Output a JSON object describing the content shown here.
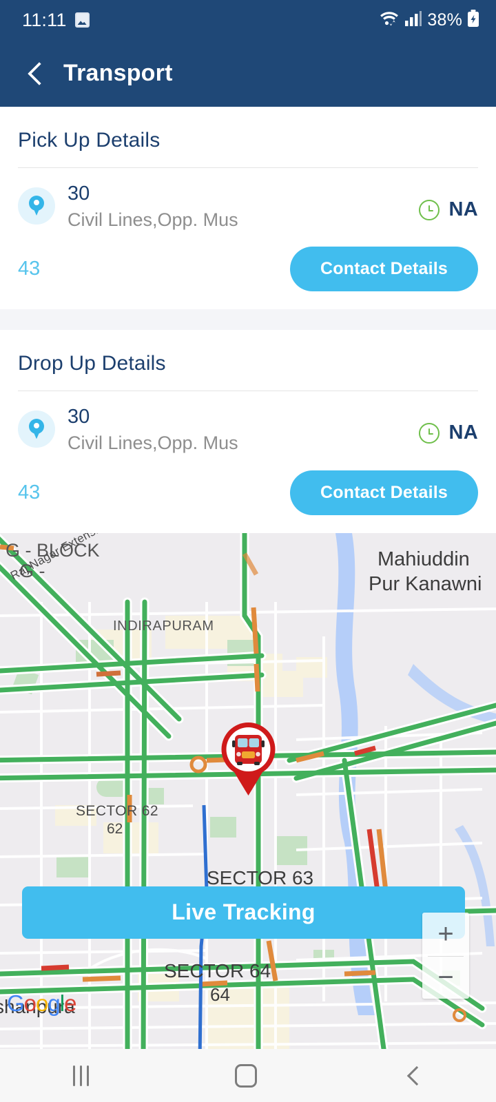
{
  "status_bar": {
    "time": "11:11",
    "image_icon": "image-icon",
    "wifi_icon": "wifi-icon",
    "signal_icon": "signal-bars-icon",
    "battery_percent": "38%",
    "battery_icon": "battery-charging-icon"
  },
  "app_bar": {
    "back_icon": "back-chevron-icon",
    "title": "Transport",
    "background_color": "#1f4877"
  },
  "pickup": {
    "title": "Pick Up Details",
    "pin_icon": "map-pin-icon",
    "stop_code": "30",
    "address": "Civil Lines,Opp. Mus",
    "clock_icon": "clock-icon",
    "eta": "NA",
    "route_number": "43",
    "contact_button": "Contact Details"
  },
  "drop": {
    "title": "Drop Up Details",
    "pin_icon": "map-pin-icon",
    "stop_code": "30",
    "address": "Civil Lines,Opp. Mus",
    "clock_icon": "clock-icon",
    "eta": "NA",
    "route_number": "43",
    "contact_button": "Contact Details"
  },
  "map": {
    "labels": {
      "g_block": "G - BLOCK",
      "g_dash": "G -",
      "raj_nagar_road": "Raj Nagar Extension Elevated Rd",
      "indirapuram": "INDIRAPURAM",
      "mahiuddin_line1": "Mahiuddin",
      "mahiuddin_line2": "Pur Kanawni",
      "sector62": "SECTOR 62",
      "sector62_num": "62",
      "sector63": "SECTOR 63",
      "sector64": "SECTOR 64",
      "sector64_num": "64",
      "shanpura": "shanpura"
    },
    "bus_marker_icon": "bus-marker-pin-icon",
    "live_tracking_button": "Live Tracking",
    "zoom_in": "+",
    "zoom_out": "−",
    "attribution": "Google",
    "traffic_colors": {
      "free": "#43b05c",
      "slow": "#e08a3c",
      "jam": "#d63b2f"
    }
  },
  "nav_bar": {
    "recents_icon": "recents-icon",
    "home_icon": "home-icon",
    "back_icon": "back-icon"
  },
  "theme": {
    "primary_navy": "#1f4877",
    "accent_blue": "#41bdee",
    "light_blue": "#57c4ec",
    "green": "#6fbf4b",
    "muted_text": "#8e8e8e"
  }
}
